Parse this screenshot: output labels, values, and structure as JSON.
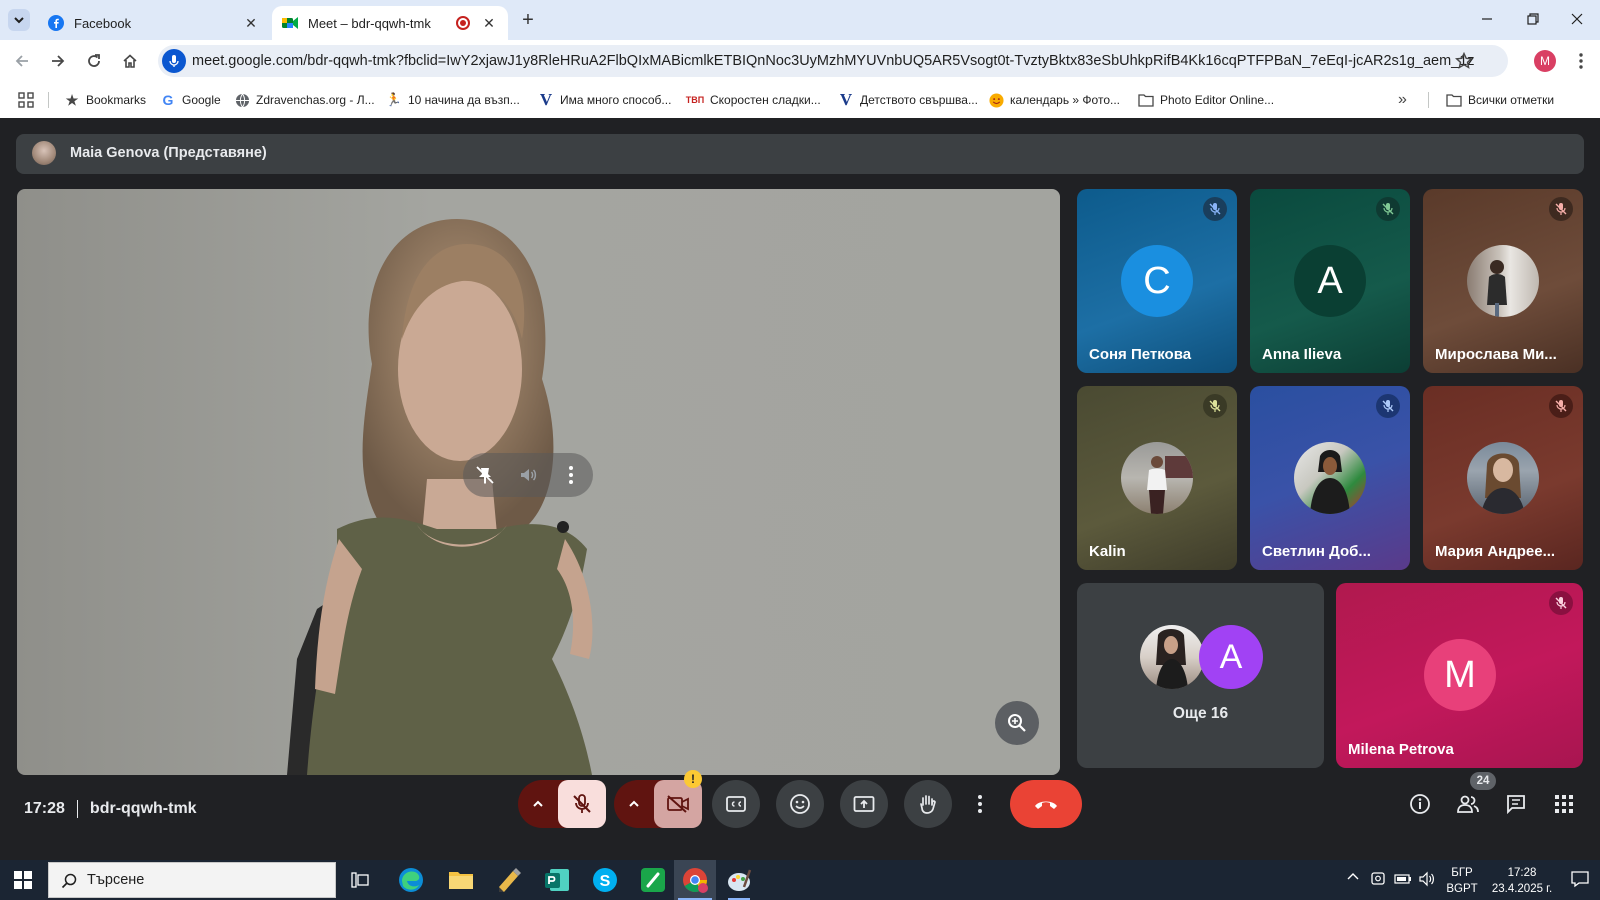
{
  "browser": {
    "tabs": [
      {
        "title": "Facebook",
        "active": false
      },
      {
        "title": "Meet – bdr-qqwh-tmk",
        "active": true
      }
    ],
    "url": "meet.google.com/bdr-qqwh-tmk?fbclid=IwY2xjawJ1y8RleHRuA2FlbQIxMABicmlkETBIQnNoc3UyMzhMYUVnbUQ5AR5Vsogt0t-TvztyBktx83eSbUhkpRifB4Kk16cqPTFPBaN_7eEqI-jcAR2s1g_aem_1z3Eee7plzEN...",
    "profile_initial": "M",
    "bookmarks": [
      {
        "label": "Bookmarks",
        "icon": "star-icon"
      },
      {
        "label": "Google",
        "icon": "google-icon"
      },
      {
        "label": "Zdravenchas.org - Л...",
        "icon": "globe-icon"
      },
      {
        "label": "10 начина да възп...",
        "icon": "runner-icon"
      },
      {
        "label": "Има много способ...",
        "icon": "v-icon"
      },
      {
        "label": "Скоростен сладки...",
        "icon": "tbp-icon"
      },
      {
        "label": "Детството свършва...",
        "icon": "v-icon"
      },
      {
        "label": "календарь » Фото...",
        "icon": "smiley-icon"
      },
      {
        "label": "Photo Editor Online...",
        "icon": "folder-icon"
      }
    ],
    "all_bookmarks": "Всички отметки"
  },
  "meet": {
    "presenter": "Maia Genova (Представяне)",
    "tiles": [
      {
        "name": "Соня Петкова",
        "initial": "C",
        "type": "letter"
      },
      {
        "name": "Anna Ilieva",
        "initial": "A",
        "type": "letter"
      },
      {
        "name": "Мирослава Ми...",
        "type": "photo"
      },
      {
        "name": "Kalin",
        "type": "photo"
      },
      {
        "name": "Светлин Доб...",
        "type": "photo"
      },
      {
        "name": "Мария Андрее...",
        "type": "photo"
      },
      {
        "name": "Milena Petrova",
        "initial": "M",
        "type": "letter"
      }
    ],
    "more": {
      "label": "Още 16",
      "initial": "A"
    },
    "time": "17:28",
    "meeting_code": "bdr-qqwh-tmk",
    "participant_count": "24",
    "colors": {
      "end_call": "#ea4335",
      "mic_off_bg": "#f9dedc",
      "dark_red": "#601410",
      "tile_blue": "#1565a0",
      "tile_green": "#0f4a3f",
      "tile_pink": "#c2185b"
    }
  },
  "taskbar": {
    "search_placeholder": "Търсене",
    "lang_top": "БГР",
    "lang_bottom": "BGPT",
    "clock_time": "17:28",
    "clock_date": "23.4.2025 г."
  }
}
